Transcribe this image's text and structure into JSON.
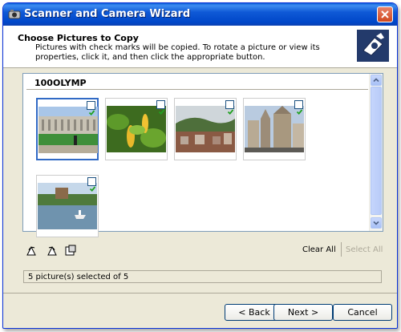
{
  "window": {
    "title": "Scanner and Camera Wizard"
  },
  "header": {
    "title": "Choose Pictures to Copy",
    "description": "Pictures with check marks will be copied. To rotate a picture or view its properties, click it, and then click the appropriate button."
  },
  "folder": {
    "label": "100OLYMP"
  },
  "thumbnails": [
    {
      "icon": "palace-photo",
      "checked": true,
      "selected": true
    },
    {
      "icon": "flowers-photo",
      "checked": true,
      "selected": false
    },
    {
      "icon": "hillside-town-photo",
      "checked": true,
      "selected": false
    },
    {
      "icon": "cathedral-photo",
      "checked": true,
      "selected": false
    },
    {
      "icon": "lake-boat-photo",
      "checked": true,
      "selected": false
    }
  ],
  "toolbar": {
    "icons": [
      "rotate-left-icon",
      "rotate-right-icon",
      "properties-icon"
    ],
    "clear_all": "Clear All",
    "select_all": "Select All"
  },
  "status": {
    "text": "5 picture(s) selected of 5"
  },
  "buttons": {
    "back": "< Back",
    "next": "Next >",
    "cancel": "Cancel"
  },
  "colors": {
    "title_bar": "#0054e3",
    "selection": "#316ac5",
    "dialog_bg": "#ece9d8"
  }
}
